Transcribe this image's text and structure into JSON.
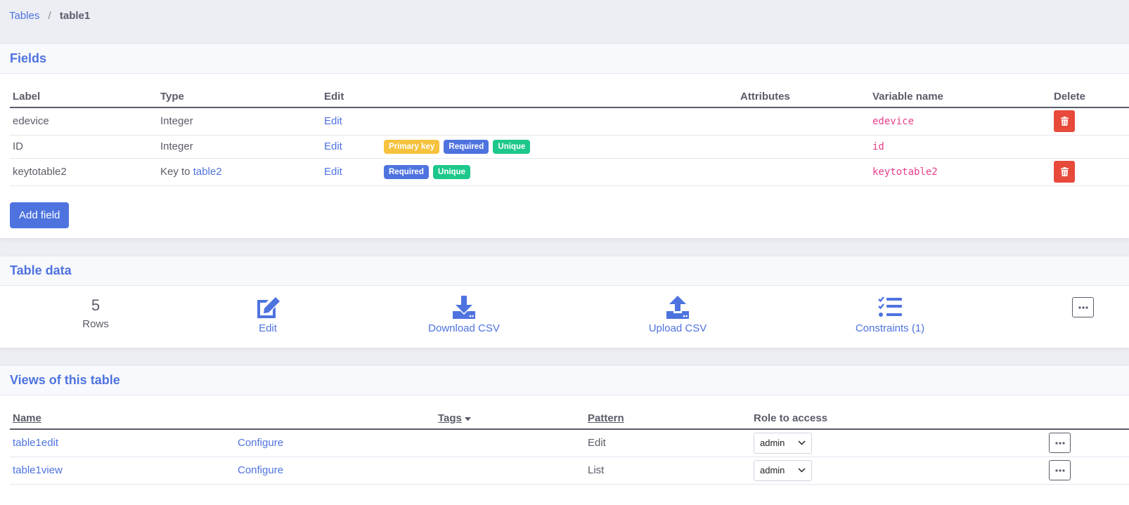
{
  "breadcrumb": {
    "root": "Tables",
    "separator": "/",
    "current": "table1"
  },
  "fields": {
    "title": "Fields",
    "headers": {
      "label": "Label",
      "type": "Type",
      "edit": "Edit",
      "attributes": "Attributes",
      "variable": "Variable name",
      "delete": "Delete"
    },
    "rows": [
      {
        "label": "edevice",
        "type": "Integer",
        "type_prefix": "",
        "type_link": "",
        "edit": "Edit",
        "badges": [],
        "variable": "edevice",
        "deletable": true
      },
      {
        "label": "ID",
        "type": "Integer",
        "type_prefix": "",
        "type_link": "",
        "edit": "Edit",
        "badges": [
          {
            "text": "Primary key",
            "kind": "warning"
          },
          {
            "text": "Required",
            "kind": "primary"
          },
          {
            "text": "Unique",
            "kind": "success"
          }
        ],
        "variable": "id",
        "deletable": false
      },
      {
        "label": "keytotable2",
        "type": "",
        "type_prefix": "Key to ",
        "type_link": "table2",
        "edit": "Edit",
        "badges": [
          {
            "text": "Required",
            "kind": "primary"
          },
          {
            "text": "Unique",
            "kind": "success"
          }
        ],
        "variable": "keytotable2",
        "deletable": true
      }
    ],
    "add_button": "Add field"
  },
  "table_data": {
    "title": "Table data",
    "rows_count": "5",
    "rows_label": "Rows",
    "edit_label": "Edit",
    "download_label": "Download CSV",
    "upload_label": "Upload CSV",
    "constraints_label": "Constraints (1)"
  },
  "views": {
    "title": "Views of this table",
    "headers": {
      "name": "Name",
      "tags": "Tags",
      "pattern": "Pattern",
      "role": "Role to access"
    },
    "rows": [
      {
        "name": "table1edit",
        "configure": "Configure",
        "pattern": "Edit",
        "role": "admin"
      },
      {
        "name": "table1view",
        "configure": "Configure",
        "pattern": "List",
        "role": "admin"
      }
    ]
  },
  "colors": {
    "primary": "#4e73df",
    "danger": "#e74a3b",
    "warning": "#f6c23e",
    "success": "#1cc88a",
    "code": "#e83e8c"
  }
}
